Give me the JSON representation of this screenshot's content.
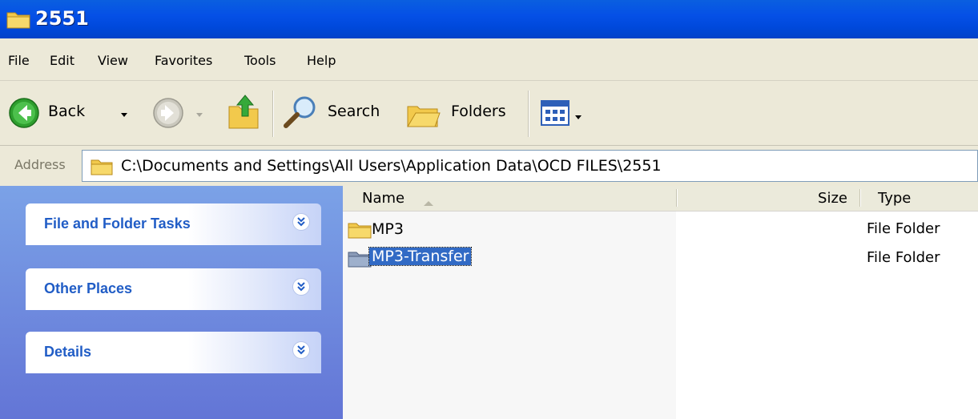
{
  "window": {
    "title": "2551"
  },
  "menu": [
    "File",
    "Edit",
    "View",
    "Favorites",
    "Tools",
    "Help"
  ],
  "toolbar": {
    "back_label": "Back",
    "search_label": "Search",
    "folders_label": "Folders"
  },
  "address": {
    "label": "Address",
    "path": "C:\\Documents and Settings\\All Users\\Application Data\\OCD FILES\\2551"
  },
  "tasks": [
    {
      "title": "File and Folder Tasks"
    },
    {
      "title": "Other Places"
    },
    {
      "title": "Details"
    }
  ],
  "columns": {
    "name": "Name",
    "size": "Size",
    "type": "Type"
  },
  "files": [
    {
      "name": "MP3",
      "size": "",
      "type": "File Folder",
      "selected": false
    },
    {
      "name": "MP3-Transfer",
      "size": "",
      "type": "File Folder",
      "selected": true
    }
  ],
  "colors": {
    "title_bar": "#0550e6",
    "task_title": "#215dc6",
    "selection": "#316ac5",
    "left_pane": "#6f8ddf"
  }
}
